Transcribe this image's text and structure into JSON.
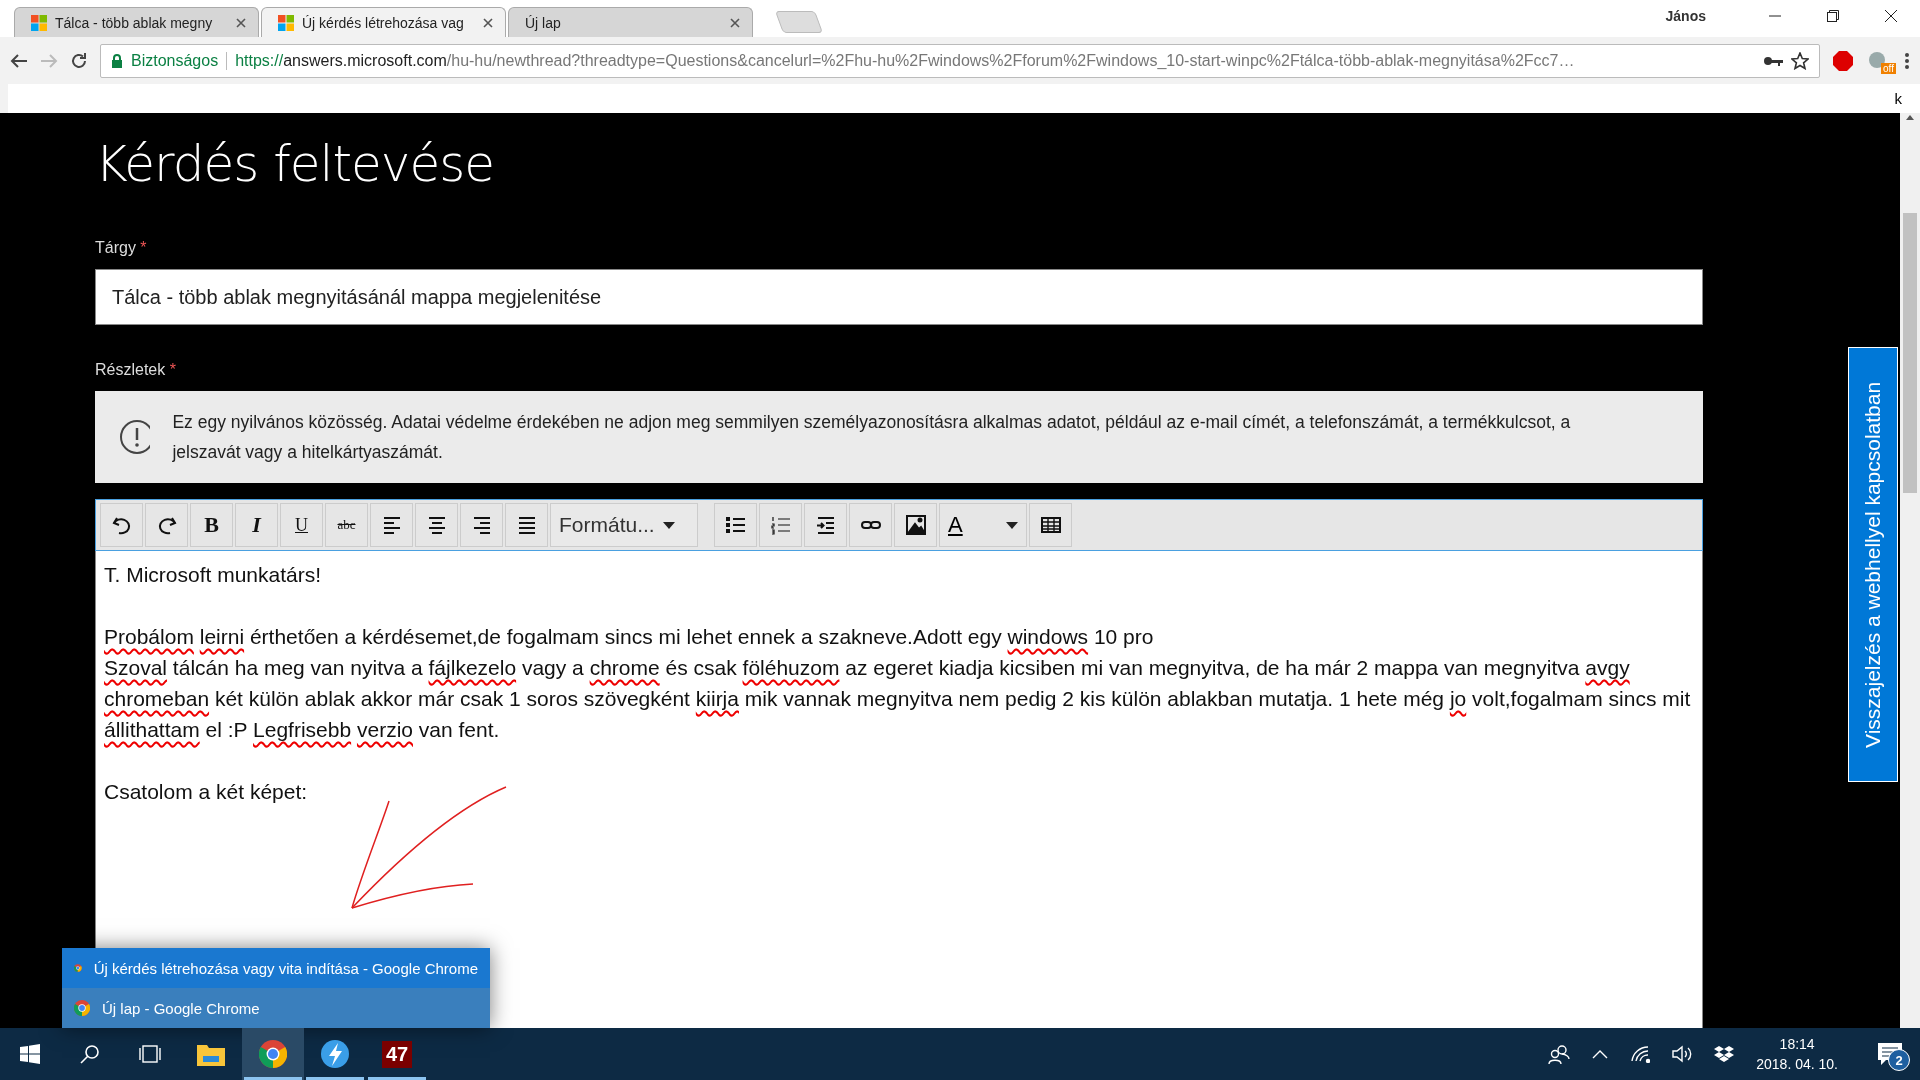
{
  "browser": {
    "tabs": [
      {
        "title": "Tálca - több ablak megny",
        "kind": "site",
        "selected": false
      },
      {
        "title": "Új kérdés létrehozása vag",
        "kind": "site",
        "selected": true
      },
      {
        "title": "Új lap",
        "kind": "blank",
        "selected": false
      }
    ],
    "user": "János",
    "address": {
      "secure_label": "Biztonságos",
      "scheme": "https://",
      "host": "answers.microsoft.com",
      "path": "/hu-hu/newthread?threadtype=Questions&cancelurl=%2Fhu-hu%2Fwindows%2Fforum%2Fwindows_10-start-winpc%2Ftálca-több-ablak-megnyitása%2Fcc7…"
    },
    "extension_badge": "off",
    "strip_text": "k"
  },
  "page": {
    "title": "Kérdés feltevése",
    "subject": {
      "label": "Tárgy",
      "required": "*",
      "value": "Tálca - több ablak megnyitásánál mappa megjelenitése"
    },
    "details": {
      "label": "Részletek",
      "required": "*"
    },
    "notice": "Ez egy nyilvános közösség. Adatai védelme érdekében ne adjon meg semmilyen személyazonosításra alkalmas adatot, például az e-mail címét, a telefonszámát, a termékkulcsot, a jelszavát vagy a hitelkártyaszámát.",
    "toolbar": {
      "bold": "B",
      "italic": "I",
      "underline": "U",
      "strike": "abc",
      "format": "Formátu...",
      "font_color": "A"
    },
    "editor": {
      "paragraphs": [
        {
          "lines": [
            [
              {
                "text": "T. Microsoft munkatárs!",
                "misspelled": false
              }
            ]
          ]
        },
        {
          "lines": [
            [
              {
                "text": "Probálom",
                "misspelled": true
              },
              {
                "text": "leirni",
                "misspelled": true,
                "space_before": true
              },
              {
                "text": " érthetően a kérdésemet,de fogalmam sincs mi lehet ennek a szakneve.Adott egy ",
                "misspelled": false
              },
              {
                "text": "windows",
                "misspelled": true
              },
              {
                "text": " 10 pro",
                "misspelled": false
              }
            ],
            [
              {
                "text": "Szoval",
                "misspelled": true
              },
              {
                "text": " tálcán ha meg van nyitva a ",
                "misspelled": false
              },
              {
                "text": "fájlkezelo",
                "misspelled": true
              },
              {
                "text": " vagy a ",
                "misspelled": false
              },
              {
                "text": "chrome",
                "misspelled": true
              },
              {
                "text": " és csak ",
                "misspelled": false
              },
              {
                "text": "föléhuzom",
                "misspelled": true
              },
              {
                "text": " az egeret kiadja kicsiben mi van megnyitva, de ha már 2 mappa van megnyitva ",
                "misspelled": false
              },
              {
                "text": "avgy",
                "misspelled": true
              },
              {
                "text": "chromeban",
                "misspelled": true,
                "space_before": true
              },
              {
                "text": " két külön ablak akkor már csak 1 soros szövegként ",
                "misspelled": false
              },
              {
                "text": "kiirja",
                "misspelled": true
              },
              {
                "text": " mik vannak megnyitva nem pedig 2 kis külön ablakban mutatja. 1 hete még ",
                "misspelled": false
              },
              {
                "text": "jo",
                "misspelled": true
              },
              {
                "text": " volt,fogalmam sincs mit ",
                "misspelled": false
              },
              {
                "text": "állithattam",
                "misspelled": true
              },
              {
                "text": " el :P  ",
                "misspelled": false
              },
              {
                "text": "Legfrisebb",
                "misspelled": true
              },
              {
                "text": "verzio",
                "misspelled": true,
                "space_before": true
              },
              {
                "text": " van fent.",
                "misspelled": false
              }
            ]
          ]
        },
        {
          "lines": [
            [
              {
                "text": "Csatolom a két képet:",
                "misspelled": false
              }
            ]
          ]
        }
      ]
    },
    "feedback": "Visszajelzés a webhellyel kapcsolatban"
  },
  "taskbar": {
    "popup": [
      {
        "title": "Új kérdés létrehozása vagy vita indítása - Google Chrome",
        "selected": true
      },
      {
        "title": "Új lap - Google Chrome",
        "selected": false
      }
    ],
    "apps": [
      {
        "kind": "explorer",
        "running": false,
        "selected": false
      },
      {
        "kind": "chrome",
        "running": true,
        "selected": true
      },
      {
        "kind": "bolt",
        "running": true,
        "selected": false
      },
      {
        "kind": "counter",
        "label": "47",
        "running": true,
        "selected": false
      }
    ],
    "time": "18:14",
    "date": "2018. 04. 10.",
    "notifications": "2"
  }
}
